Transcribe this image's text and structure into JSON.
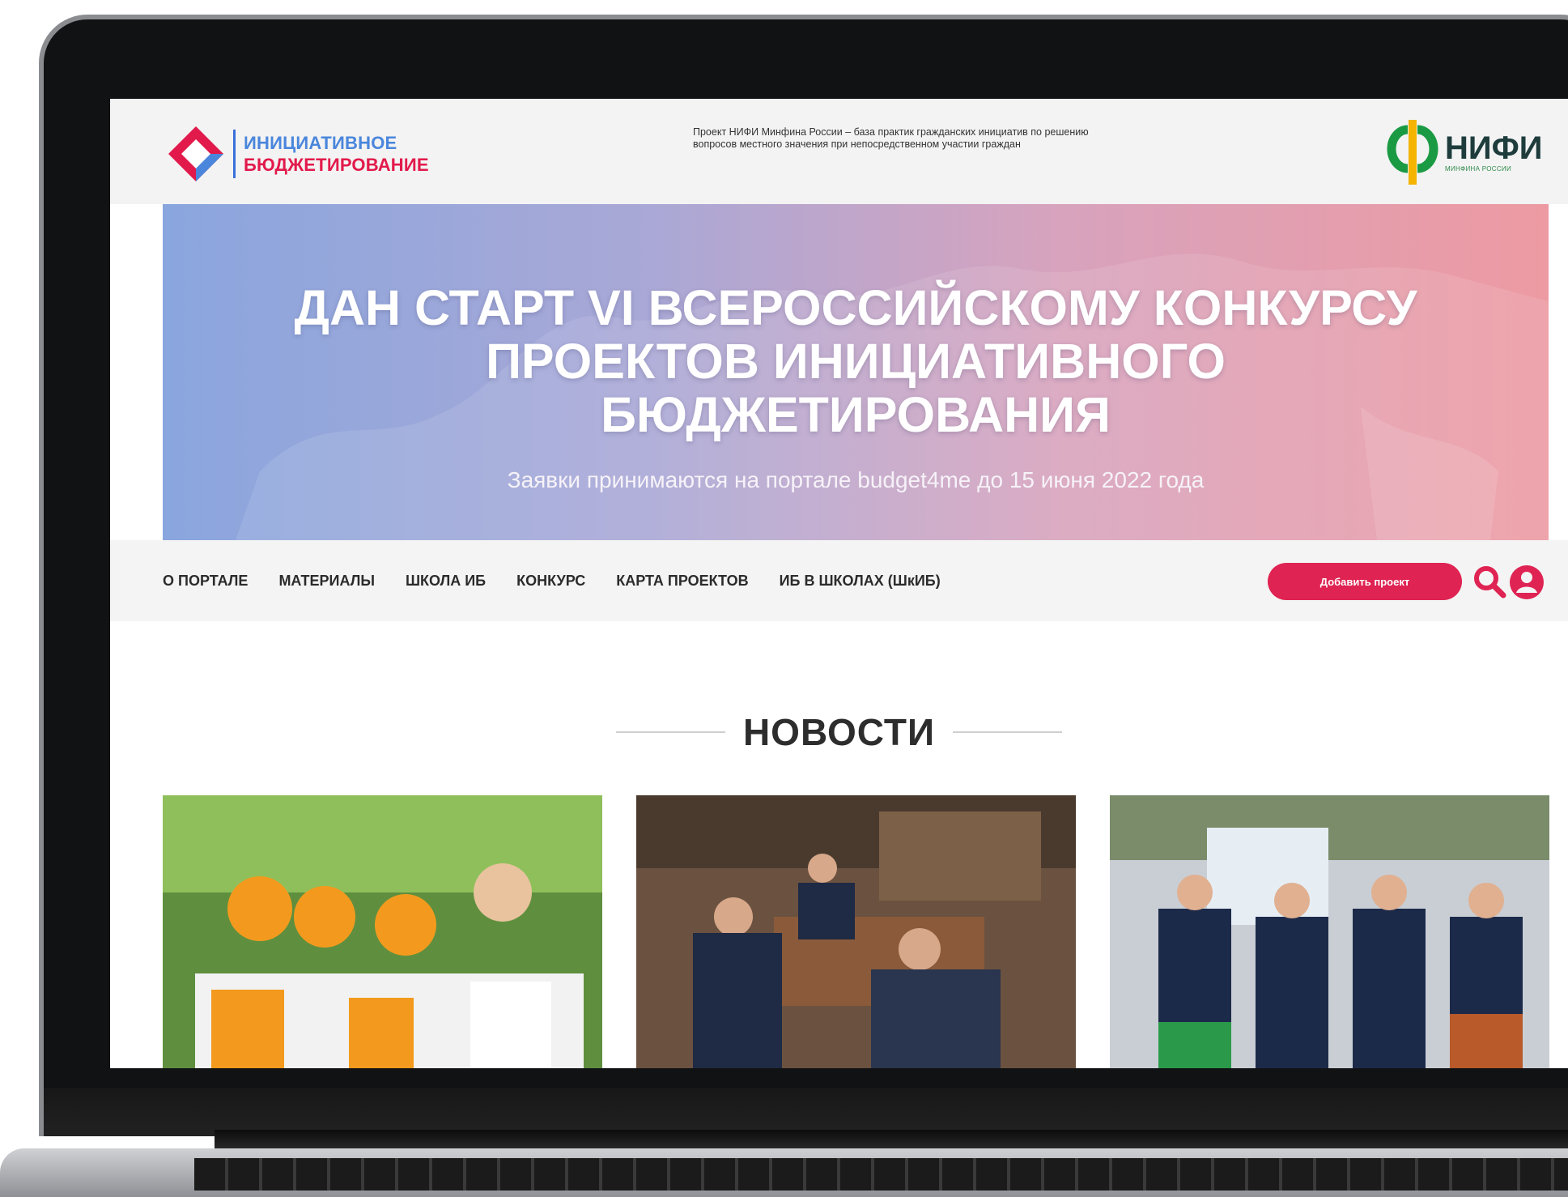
{
  "logo": {
    "line1": "ИНИЦИАТИВНОЕ",
    "line2": "БЮДЖЕТИРОВАНИЕ",
    "colors": {
      "blue": "#4a86dc",
      "red": "#e21a4b"
    }
  },
  "header": {
    "description": "Проект НИФИ Минфина России – база практик гражданских инициатив по решению вопросов местного значения при непосредственном участии граждан"
  },
  "partner_logo": {
    "title": "НИФИ",
    "subtitle": "МИНФИНА РОССИИ"
  },
  "banner": {
    "title_lines": [
      "ДАН СТАРТ VI ВСЕРОССИЙСКОМУ КОНКУРСУ",
      "ПРОЕКТОВ ИНИЦИАТИВНОГО",
      "БЮДЖЕТИРОВАНИЯ"
    ],
    "subtitle": "Заявки принимаются на портале budget4me до 15 июня 2022 года"
  },
  "nav": {
    "items": [
      "О ПОРТАЛЕ",
      "МАТЕРИАЛЫ",
      "ШКОЛА ИБ",
      "КОНКУРС",
      "КАРТА ПРОЕКТОВ",
      "ИБ В ШКОЛАХ (ШкИБ)"
    ],
    "add_button": "Добавить проект",
    "accent_color": "#df2352"
  },
  "news": {
    "heading": "НОВОСТИ",
    "cards": [
      {
        "image": "children-orange-caps-photo"
      },
      {
        "image": "meeting-officials-photo"
      },
      {
        "image": "students-celebrating-photo"
      }
    ]
  }
}
